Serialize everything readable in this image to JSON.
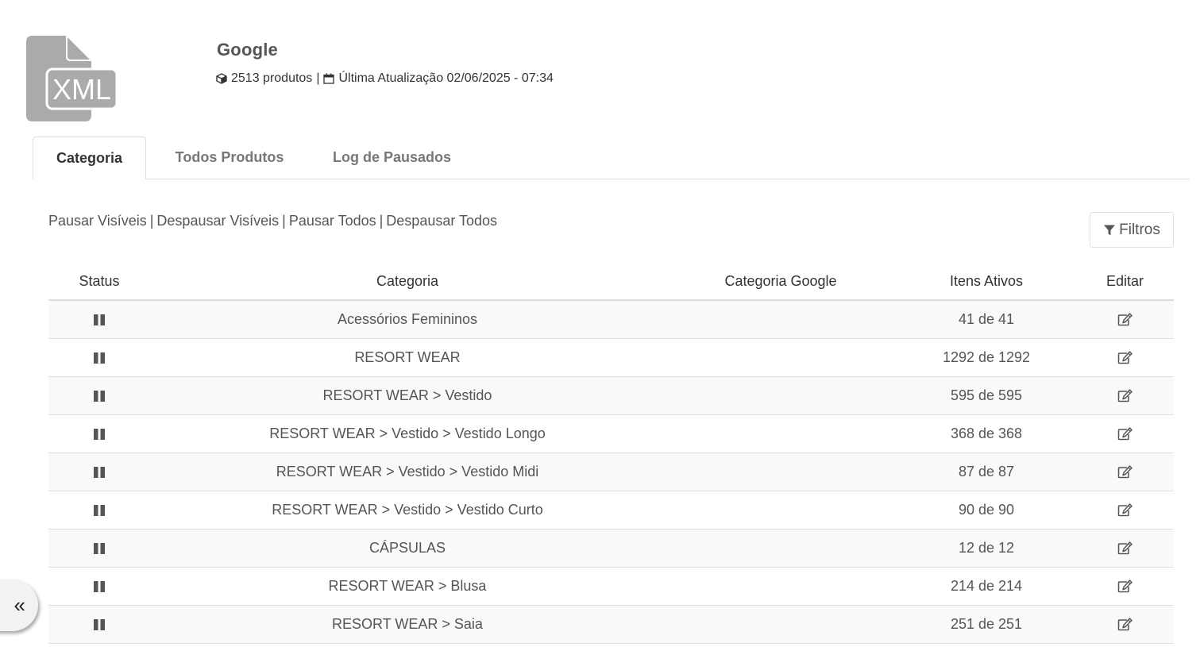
{
  "feed": {
    "title": "Google",
    "product_count": "2513 produtos",
    "separator": "|",
    "last_update": "Última Atualização 02/06/2025 - 07:34",
    "logo_text": "XML"
  },
  "tabs": [
    {
      "label": "Categoria",
      "active": true
    },
    {
      "label": "Todos Produtos",
      "active": false
    },
    {
      "label": "Log de Pausados",
      "active": false
    }
  ],
  "actions": {
    "pause_visible": "Pausar Visíveis",
    "unpause_visible": "Despausar Visíveis",
    "pause_all": "Pausar Todos",
    "unpause_all": "Despausar Todos",
    "separator": "|"
  },
  "filter_button": {
    "label": "Filtros",
    "icon": "filter-icon"
  },
  "table": {
    "headers": {
      "status": "Status",
      "category": "Categoria",
      "google_category": "Categoria Google",
      "active_items": "Itens Ativos",
      "edit": "Editar"
    },
    "rows": [
      {
        "status_icon": "pause-icon",
        "category": "Acessórios Femininos",
        "google_category": "",
        "active_items": "41 de 41",
        "edit_icon": "edit-icon"
      },
      {
        "status_icon": "pause-icon",
        "category": "RESORT WEAR",
        "google_category": "",
        "active_items": "1292 de 1292",
        "edit_icon": "edit-icon"
      },
      {
        "status_icon": "pause-icon",
        "category": "RESORT WEAR > Vestido",
        "google_category": "",
        "active_items": "595 de 595",
        "edit_icon": "edit-icon"
      },
      {
        "status_icon": "pause-icon",
        "category": "RESORT WEAR > Vestido > Vestido Longo",
        "google_category": "",
        "active_items": "368 de 368",
        "edit_icon": "edit-icon"
      },
      {
        "status_icon": "pause-icon",
        "category": "RESORT WEAR > Vestido > Vestido Midi",
        "google_category": "",
        "active_items": "87 de 87",
        "edit_icon": "edit-icon"
      },
      {
        "status_icon": "pause-icon",
        "category": "RESORT WEAR > Vestido > Vestido Curto",
        "google_category": "",
        "active_items": "90 de 90",
        "edit_icon": "edit-icon"
      },
      {
        "status_icon": "pause-icon",
        "category": "CÁPSULAS",
        "google_category": "",
        "active_items": "12 de 12",
        "edit_icon": "edit-icon"
      },
      {
        "status_icon": "pause-icon",
        "category": "RESORT WEAR > Blusa",
        "google_category": "",
        "active_items": "214 de 214",
        "edit_icon": "edit-icon"
      },
      {
        "status_icon": "pause-icon",
        "category": "RESORT WEAR > Saia",
        "google_category": "",
        "active_items": "251 de 251",
        "edit_icon": "edit-icon"
      }
    ]
  },
  "sidebar_toggle": {
    "label": "«",
    "icon": "double-chevron-left-icon"
  },
  "colors": {
    "text": "#555555",
    "text_dark": "#333333",
    "border": "#dddddd",
    "row_stripe": "#f9f9f9",
    "logo": "#aaaaaa"
  }
}
